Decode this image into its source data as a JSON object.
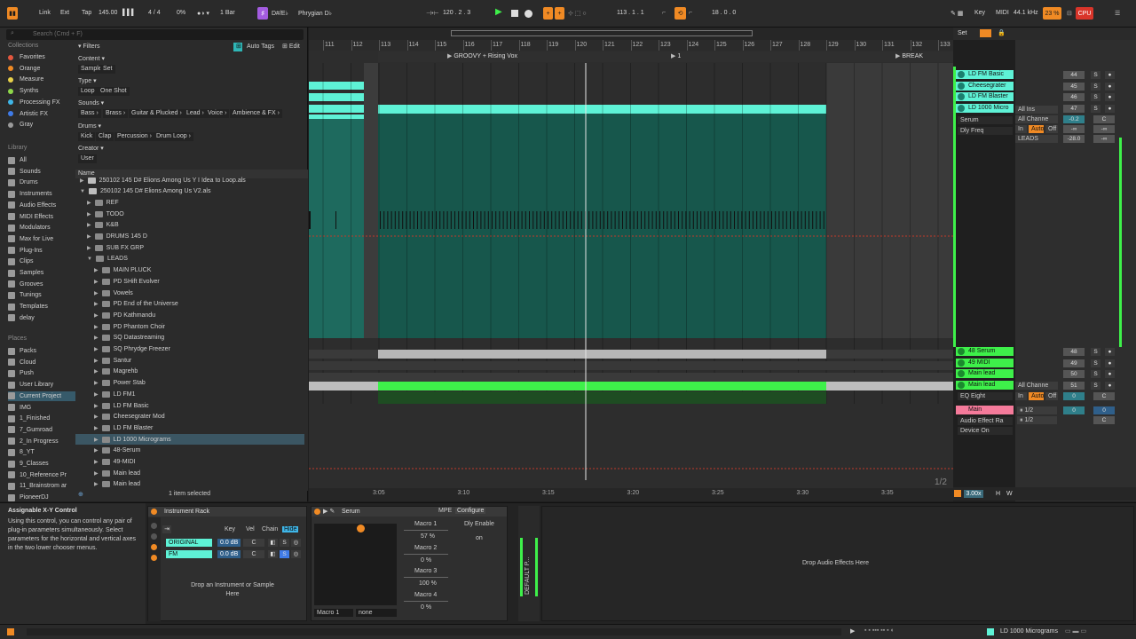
{
  "topbar": {
    "link": "Link",
    "ext": "Ext",
    "tap": "Tap",
    "tempo": "145.00",
    "signature": "4 / 4",
    "cpu_percent_left": "0%",
    "quantize": "1 Bar",
    "key": "D#/E♭",
    "scale": "Phrygian D♭",
    "position": "120 .  2 .  3",
    "loop_start": "113 .  1 .  1",
    "loop_length": "18 .  0 .  0",
    "key_label": "Key",
    "midi_label": "MIDI",
    "sample_rate": "44.1 kHz",
    "cpu_percent": "23 %",
    "cpu_label": "CPU"
  },
  "browser": {
    "search_placeholder": "Search (Cmd + F)",
    "collections_title": "Collections",
    "collections": [
      {
        "label": "Favorites",
        "color": "#e4573e"
      },
      {
        "label": "Orange",
        "color": "#f08a24"
      },
      {
        "label": "Measure",
        "color": "#e8d14a"
      },
      {
        "label": "Synths",
        "color": "#8ed84a"
      },
      {
        "label": "Processing FX",
        "color": "#3fb6e8"
      },
      {
        "label": "Artistic FX",
        "color": "#3f7be8"
      },
      {
        "label": "Gray",
        "color": "#9a9a9a"
      }
    ],
    "library_title": "Library",
    "library": [
      "All",
      "Sounds",
      "Drums",
      "Instruments",
      "Audio Effects",
      "MIDI Effects",
      "Modulators",
      "Max for Live",
      "Plug-Ins",
      "Clips",
      "Samples",
      "Grooves",
      "Tunings",
      "Templates",
      "delay"
    ],
    "places_title": "Places",
    "places": [
      "Packs",
      "Cloud",
      "Push",
      "User Library",
      "Current Project",
      "IMG",
      "1_Finished",
      "7_Gumroad",
      "2_In Progress",
      "8_YT",
      "9_Classes",
      "10_Reference Pr",
      "11_Brainstrom ar",
      "PioneerDJ"
    ],
    "places_selected": "Current Project",
    "filters": {
      "title": "Filters",
      "auto_tags": "Auto Tags",
      "edit": "Edit",
      "content_label": "Content ▾",
      "content": [
        "Sample",
        "Set"
      ],
      "type_label": "Type ▾",
      "type": [
        "Loop",
        "One Shot"
      ],
      "sounds_label": "Sounds ▾",
      "sounds": [
        "Bass ›",
        "Brass ›",
        "Guitar & Plucked ›",
        "Lead ›",
        "Voice ›",
        "Ambience & FX ›"
      ],
      "drums_label": "Drums ▾",
      "drums": [
        "Kick",
        "Clap",
        "Percussion ›",
        "Drum Loop ›"
      ],
      "creator_label": "Creator ▾",
      "creator": [
        "User"
      ]
    },
    "list_header": "Name",
    "files": [
      {
        "label": "250102 145 D# Elions Among Us Y I Idea to Loop.als",
        "indent": 0,
        "kind": "file"
      },
      {
        "label": "250102 145 D# Elions Among Us V2.als",
        "indent": 0,
        "kind": "file",
        "open": true
      },
      {
        "label": "REF",
        "indent": 1,
        "kind": "folder"
      },
      {
        "label": "TODO",
        "indent": 1,
        "kind": "folder"
      },
      {
        "label": "K&B",
        "indent": 1,
        "kind": "folder"
      },
      {
        "label": "DRUMS 145 D",
        "indent": 1,
        "kind": "folder"
      },
      {
        "label": "SUB FX GRP",
        "indent": 1,
        "kind": "folder"
      },
      {
        "label": "LEADS",
        "indent": 1,
        "kind": "folder",
        "open": true
      },
      {
        "label": "MAIN PLUCK",
        "indent": 2,
        "kind": "folder"
      },
      {
        "label": "PD SHift Evolver",
        "indent": 2,
        "kind": "folder"
      },
      {
        "label": "Vowels",
        "indent": 2,
        "kind": "folder"
      },
      {
        "label": "PD End of the Universe",
        "indent": 2,
        "kind": "folder"
      },
      {
        "label": "PD Kathmandu",
        "indent": 2,
        "kind": "folder"
      },
      {
        "label": "PD Phantom Choir",
        "indent": 2,
        "kind": "folder"
      },
      {
        "label": "SQ Datastreaming",
        "indent": 2,
        "kind": "folder"
      },
      {
        "label": "SQ Phrydge Freezer",
        "indent": 2,
        "kind": "folder"
      },
      {
        "label": "Santur",
        "indent": 2,
        "kind": "folder"
      },
      {
        "label": "Magrehb",
        "indent": 2,
        "kind": "folder"
      },
      {
        "label": "Power Stab",
        "indent": 2,
        "kind": "folder"
      },
      {
        "label": "LD FM1",
        "indent": 2,
        "kind": "folder"
      },
      {
        "label": "LD FM Basic",
        "indent": 2,
        "kind": "folder"
      },
      {
        "label": "Cheesegrater Mod",
        "indent": 2,
        "kind": "folder"
      },
      {
        "label": "LD FM Blaster",
        "indent": 2,
        "kind": "folder"
      },
      {
        "label": "LD 1000 Micrograms",
        "indent": 2,
        "kind": "folder",
        "selected": true
      },
      {
        "label": "48-Serum",
        "indent": 2,
        "kind": "folder"
      },
      {
        "label": "49-MIDI",
        "indent": 2,
        "kind": "folder"
      },
      {
        "label": "Main lead",
        "indent": 2,
        "kind": "folder"
      },
      {
        "label": "Main lead",
        "indent": 2,
        "kind": "folder"
      }
    ],
    "status": "1 item selected"
  },
  "arrangement": {
    "bars": [
      "111",
      "112",
      "113",
      "114",
      "115",
      "116",
      "117",
      "118",
      "119",
      "120",
      "121",
      "122",
      "123",
      "124",
      "125",
      "126",
      "127",
      "128",
      "129",
      "130",
      "131",
      "132",
      "133"
    ],
    "locators": [
      "GROOVY + Rising Vox",
      "1",
      "BREAK"
    ],
    "times": [
      "3:05",
      "3:10",
      "3:15",
      "3:20",
      "3:25",
      "3:30",
      "3:35"
    ],
    "page": "1/2",
    "zoom": "3.00x",
    "h_label": "H",
    "w_label": "W",
    "colors": {
      "teal": "#5ef2d6",
      "teal_dark": "#17574c",
      "green": "#3ef04a"
    }
  },
  "mixer": {
    "set_label": "Set",
    "tracks": [
      {
        "name": "LD FM Basic",
        "vol": "44",
        "color": "#5ef2d6"
      },
      {
        "name": "Cheesegrater",
        "vol": "45",
        "color": "#5ef2d6"
      },
      {
        "name": "LD FM Blaster",
        "vol": "46",
        "color": "#5ef2d6"
      },
      {
        "name": "LD 1000 Micro",
        "vol": "47",
        "color": "#5ef2d6"
      }
    ],
    "input_type": "All Ins",
    "input_channel": "All Channe",
    "monitor": [
      "In",
      "Auto",
      "Off"
    ],
    "output": "LEADS",
    "device_serum": "Serum",
    "device_delay": "Dly Freq",
    "volume_db": "-0.2",
    "pan": "C",
    "inf": "-∞",
    "send": "-28.0",
    "lower_tracks": [
      {
        "name": "48 Serum",
        "vol": "48",
        "color": "#3ef04a"
      },
      {
        "name": "49 MIDI",
        "vol": "49",
        "color": "#3ef04a"
      },
      {
        "name": "Main lead",
        "vol": "50",
        "color": "#3ef04a"
      },
      {
        "name": "Main lead",
        "vol": "51",
        "color": "#3ef04a"
      }
    ],
    "main_lead_input": "All Channe",
    "eq_eight": "EQ Eight",
    "eq_vol": "0",
    "main": {
      "name": "Main",
      "input": "1/2",
      "output": "1/2",
      "vol": "0",
      "pan": "C",
      "send": "0"
    },
    "audio_effect_rack": "Audio Effect Ra",
    "device_on": "Device On",
    "solo": "S"
  },
  "devices": {
    "info_title": "Assignable X-Y Control",
    "info_text": "Using this control, you can control any pair of plug-in parameters simultaneously. Select parameters for the horizontal and vertical axes in the two lower chooser menus.",
    "instrument_rack": {
      "title": "Instrument Rack",
      "cols": [
        "Key",
        "Vel",
        "Chain",
        "Hide"
      ],
      "chains": [
        {
          "name": "ORIGINAL",
          "db": "0.0 dB",
          "pan": "C"
        },
        {
          "name": "FM",
          "db": "0.0 dB",
          "pan": "C"
        }
      ],
      "drop": "Drop an Instrument or Sample Here"
    },
    "serum": {
      "title": "Serum",
      "mpe": "MPE",
      "configure": "Configure",
      "macros": [
        {
          "label": "Macro 1",
          "value": "57 %"
        },
        {
          "label": "Macro 2",
          "value": "0 %"
        },
        {
          "label": "Macro 3",
          "value": "100 %"
        },
        {
          "label": "Macro 4",
          "value": "0 %"
        }
      ],
      "dly_enable": "Dly Enable",
      "dly_state": "on",
      "x_param": "Macro 1",
      "y_param": "none"
    },
    "default_label": "DEFAULT P...",
    "drop_effects": "Drop Audio Effects Here"
  },
  "footer": {
    "track_name": "LD 1000 Micrograms"
  }
}
